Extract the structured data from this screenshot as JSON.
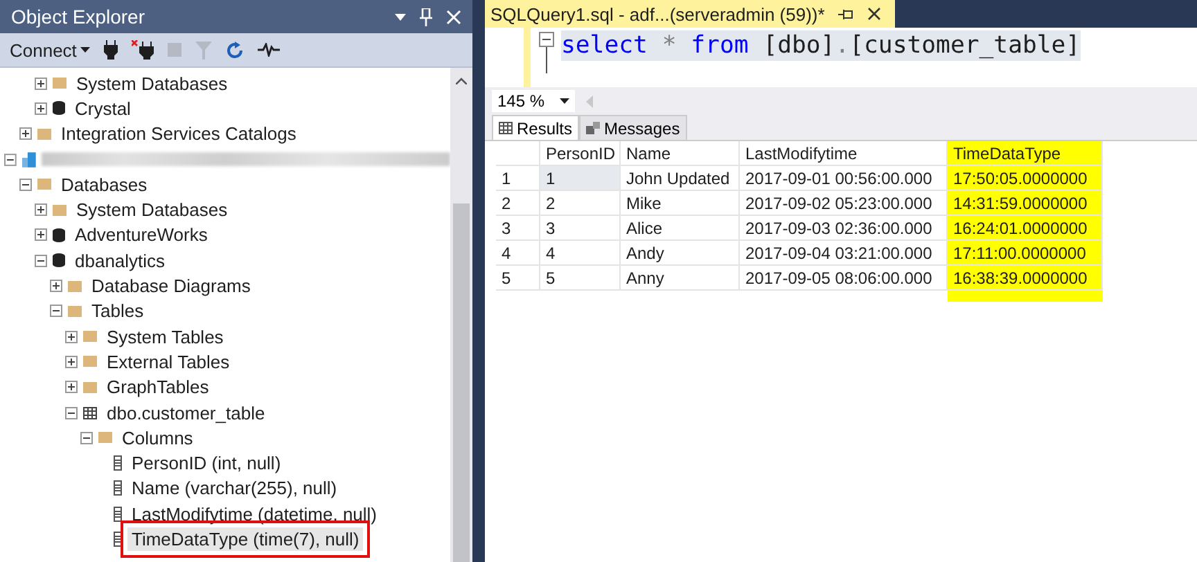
{
  "object_explorer": {
    "title": "Object Explorer",
    "toolbar": {
      "connect": "Connect",
      "buttons": [
        {
          "kind": "plug",
          "disabled": false
        },
        {
          "kind": "unplug",
          "disabled": false
        },
        {
          "kind": "stop",
          "disabled": true
        },
        {
          "kind": "filter",
          "disabled": true
        },
        {
          "kind": "refresh",
          "disabled": false
        },
        {
          "kind": "activity",
          "disabled": false
        }
      ]
    },
    "tree": [
      {
        "children": [
          {
            "children": [
              {
                "label": "System Databases",
                "kind": "folder",
                "expanded": false,
                "selected": false,
                "outlined": false
              },
              {
                "label": "Crystal",
                "kind": "database",
                "expanded": false,
                "selected": false,
                "outlined": false
              }
            ]
          },
          {
            "label": "Integration Services Catalogs",
            "kind": "folder",
            "expanded": false,
            "selected": false,
            "outlined": false
          }
        ]
      },
      {
        "redacted": true,
        "kind": "server",
        "expanded": true,
        "selected": false,
        "outlined": false,
        "children": [
          {
            "label": "Databases",
            "kind": "folder",
            "expanded": true,
            "selected": false,
            "outlined": false,
            "children": [
              {
                "label": "System Databases",
                "kind": "folder",
                "expanded": false,
                "selected": false,
                "outlined": false
              },
              {
                "label": "AdventureWorks",
                "kind": "database",
                "expanded": false,
                "selected": false,
                "outlined": false
              },
              {
                "label": "dbanalytics",
                "kind": "database",
                "expanded": true,
                "selected": false,
                "outlined": false,
                "children": [
                  {
                    "label": "Database Diagrams",
                    "kind": "folder",
                    "expanded": false,
                    "selected": false,
                    "outlined": false
                  },
                  {
                    "label": "Tables",
                    "kind": "folder",
                    "expanded": true,
                    "selected": false,
                    "outlined": false,
                    "children": [
                      {
                        "label": "System Tables",
                        "kind": "folder",
                        "expanded": false,
                        "selected": false,
                        "outlined": false
                      },
                      {
                        "label": "External Tables",
                        "kind": "folder",
                        "expanded": false,
                        "selected": false,
                        "outlined": false
                      },
                      {
                        "label": "GraphTables",
                        "kind": "folder",
                        "expanded": false,
                        "selected": false,
                        "outlined": false
                      },
                      {
                        "label": "dbo.customer_table",
                        "kind": "table",
                        "expanded": true,
                        "selected": false,
                        "outlined": false,
                        "children": [
                          {
                            "label": "Columns",
                            "kind": "folder",
                            "expanded": true,
                            "selected": false,
                            "outlined": false,
                            "children": [
                              {
                                "label": "PersonID (int, null)",
                                "kind": "column",
                                "selected": false,
                                "outlined": false
                              },
                              {
                                "label": "Name (varchar(255), null)",
                                "kind": "column",
                                "selected": false,
                                "outlined": false
                              },
                              {
                                "label": "LastModifytime (datetime, null)",
                                "kind": "column",
                                "selected": false,
                                "outlined": false
                              },
                              {
                                "label": "TimeDataType (time(7), null)",
                                "kind": "column",
                                "selected": true,
                                "outlined": true
                              }
                            ]
                          }
                        ]
                      }
                    ]
                  }
                ]
              }
            ]
          }
        ]
      }
    ]
  },
  "query": {
    "tab": {
      "title": "SQLQuery1.sql - adf...(serveradmin (59))*",
      "selected": true
    },
    "code": [
      {
        "text": "select ",
        "kind": "keyword"
      },
      {
        "text": "* ",
        "kind": "operator"
      },
      {
        "text": "from ",
        "kind": "keyword"
      },
      {
        "text": "[dbo]",
        "kind": "identifier"
      },
      {
        "text": ".",
        "kind": "operator"
      },
      {
        "text": "[customer_table]",
        "kind": "identifier"
      }
    ],
    "zoom": "145 %",
    "result_tabs": [
      {
        "label": "Results",
        "kind": "grid",
        "selected": true
      },
      {
        "label": "Messages",
        "kind": "messages",
        "selected": false
      }
    ],
    "grid": {
      "columns": [
        {
          "label": "PersonID",
          "highlighted": false
        },
        {
          "label": "Name",
          "highlighted": false
        },
        {
          "label": "LastModifytime",
          "highlighted": false
        },
        {
          "label": "TimeDataType",
          "highlighted": true
        }
      ],
      "rows": [
        {
          "number": "1",
          "focused": true,
          "cells": [
            "1",
            "John Updated",
            "2017-09-01 00:56:00.000",
            "17:50:05.0000000"
          ]
        },
        {
          "number": "2",
          "focused": false,
          "cells": [
            "2",
            "Mike",
            "2017-09-02 05:23:00.000",
            "14:31:59.0000000"
          ]
        },
        {
          "number": "3",
          "focused": false,
          "cells": [
            "3",
            "Alice",
            "2017-09-03 02:36:00.000",
            "16:24:01.0000000"
          ]
        },
        {
          "number": "4",
          "focused": false,
          "cells": [
            "4",
            "Andy",
            "2017-09-04 03:21:00.000",
            "17:11:00.0000000"
          ]
        },
        {
          "number": "5",
          "focused": false,
          "cells": [
            "5",
            "Anny",
            "2017-09-05 08:06:00.000",
            "16:38:39.0000000"
          ]
        }
      ]
    }
  }
}
